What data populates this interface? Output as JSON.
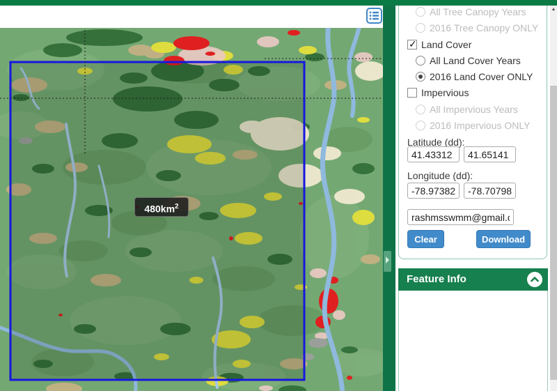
{
  "colors": {
    "brand_green": "#0b7b46",
    "panel_header_green": "#17804f",
    "button_blue": "#428bca",
    "selection_blue": "#1717dd"
  },
  "map": {
    "area_tooltip": {
      "text": "480km",
      "sup": "2"
    }
  },
  "sidebar": {
    "layer_controls": [
      {
        "type": "radio",
        "label": "All Tree Canopy Years",
        "checked": false,
        "disabled": true
      },
      {
        "type": "radio",
        "label": "2016 Tree Canopy ONLY",
        "checked": false,
        "disabled": true
      },
      {
        "type": "checkbox",
        "label": "Land Cover",
        "checked": true,
        "disabled": false
      },
      {
        "type": "radio",
        "label": "All Land Cover Years",
        "checked": false,
        "disabled": false
      },
      {
        "type": "radio",
        "label": "2016 Land Cover ONLY",
        "checked": true,
        "disabled": false
      },
      {
        "type": "checkbox",
        "label": "Impervious",
        "checked": false,
        "disabled": false
      },
      {
        "type": "radio",
        "label": "All Impervious Years",
        "checked": false,
        "disabled": true
      },
      {
        "type": "radio",
        "label": "2016 Impervious ONLY",
        "checked": false,
        "disabled": true
      }
    ],
    "latitude_label": "Latitude (dd):",
    "latitude_min": "41.43312",
    "latitude_max": "41.65141",
    "longitude_label": "Longitude (dd):",
    "longitude_min": "-78.97382",
    "longitude_max": "-78.70798",
    "email_value": "rashmsswmm@gmail.com",
    "clear_label": "Clear",
    "download_label": "Download",
    "feature_info_title": "Feature Info"
  }
}
